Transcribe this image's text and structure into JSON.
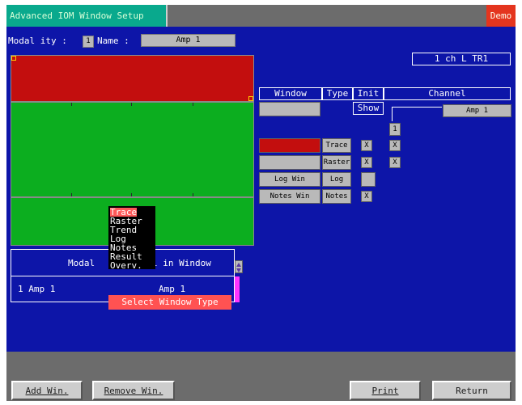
{
  "window": {
    "title": "Advanced IOM Window Setup",
    "demo": "Demo"
  },
  "modality": {
    "label": "Modal ity :",
    "number": "1",
    "name_label": "Name :",
    "name_value": "Amp 1"
  },
  "trace_info": "1 ch L TR1",
  "table_headers": {
    "window": "Window",
    "type": "Type",
    "init": "Init",
    "channel": "Channel"
  },
  "show": "Show",
  "channel_top": "Amp 1",
  "channel_num": "1",
  "rows": [
    {
      "window": "",
      "type": "Trace",
      "init": "X",
      "chan": "X",
      "color": "#c30e0e"
    },
    {
      "window": "",
      "type": "Raster",
      "init": "X",
      "chan": "X",
      "color": "#b9b9b9"
    },
    {
      "window": "Log Win",
      "type": "Log",
      "init": "",
      "chan": "",
      "color": "#b9b9b9"
    },
    {
      "window": "Notes Win",
      "type": "Notes",
      "init": "X",
      "chan": "",
      "color": "#b9b9b9"
    }
  ],
  "bottom_table": {
    "col1": "Modal",
    "col2": "l in Window",
    "row_left": "1 Amp 1",
    "row_right": "Amp 1"
  },
  "menu": {
    "items": [
      "Trace",
      "Raster",
      "Trend",
      "Log",
      "Notes",
      "Result",
      "Overv."
    ],
    "selected": "Trace"
  },
  "tooltip": "Select Window Type",
  "buttons": {
    "add": "Add Win.",
    "remove": "Remove Win.",
    "print": "Print",
    "return": "Return"
  }
}
